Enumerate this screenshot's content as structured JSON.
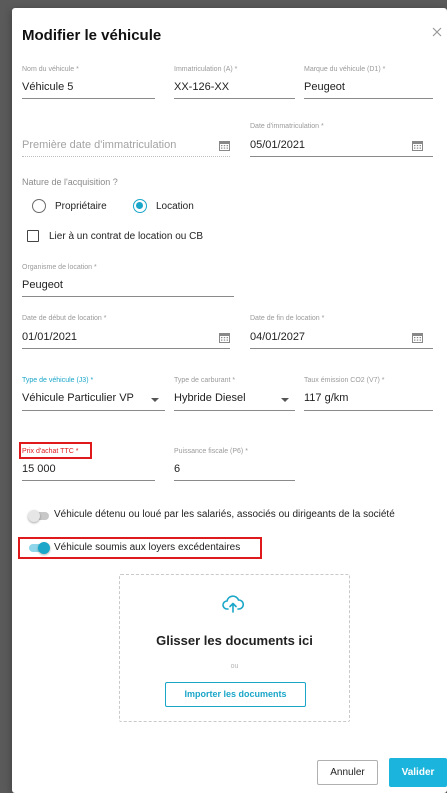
{
  "dialog": {
    "title": "Modifier le véhicule",
    "close_icon": "close-icon"
  },
  "fields": {
    "nom": {
      "label": "Nom du véhicule *",
      "value": "Véhicule 5"
    },
    "immat": {
      "label": "Immatriculation (A) *",
      "value": "XX-126-XX"
    },
    "marque": {
      "label": "Marque du véhicule (D1) *",
      "value": "Peugeot"
    },
    "premiere_date": {
      "placeholder": "Première date d'immatriculation"
    },
    "date_immat": {
      "label": "Date d'immatriculation *",
      "value": "05/01/2021"
    },
    "organisme": {
      "label": "Organisme de location *",
      "value": "Peugeot"
    },
    "date_debut": {
      "label": "Date de début de location *",
      "value": "01/01/2021"
    },
    "date_fin": {
      "label": "Date de fin de location *",
      "value": "04/01/2027"
    },
    "type_vehicule": {
      "label": "Type de véhicule (J3) *",
      "value": "Véhicule Particulier VP"
    },
    "carburant": {
      "label": "Type de carburant *",
      "value": "Hybride Diesel"
    },
    "co2": {
      "label": "Taux émission CO2 (V7) *",
      "value": "117 g/km"
    },
    "prix": {
      "label": "Prix d'achat TTC *",
      "value": "15 000"
    },
    "puissance": {
      "label": "Puissance fiscale (P6) *",
      "value": "6"
    }
  },
  "acquisition": {
    "label": "Nature de l'acquisition ?",
    "options": [
      "Propriétaire",
      "Location"
    ],
    "selected": "Location"
  },
  "lier_contrat": {
    "label": "Lier à un contrat de location ou CB",
    "checked": false
  },
  "toggles": {
    "detenu": {
      "label": "Véhicule détenu ou loué par les salariés, associés ou dirigeants de la société",
      "on": false
    },
    "loyers": {
      "label": "Véhicule soumis aux loyers excédentaires",
      "on": true
    }
  },
  "dropzone": {
    "title": "Glisser les documents ici",
    "or": "ou",
    "button": "Importer les documents"
  },
  "footer": {
    "cancel": "Annuler",
    "validate": "Valider"
  },
  "colors": {
    "accent": "#1aa6c8",
    "primary_button": "#1bb4dc",
    "highlight": "#e0191c"
  }
}
